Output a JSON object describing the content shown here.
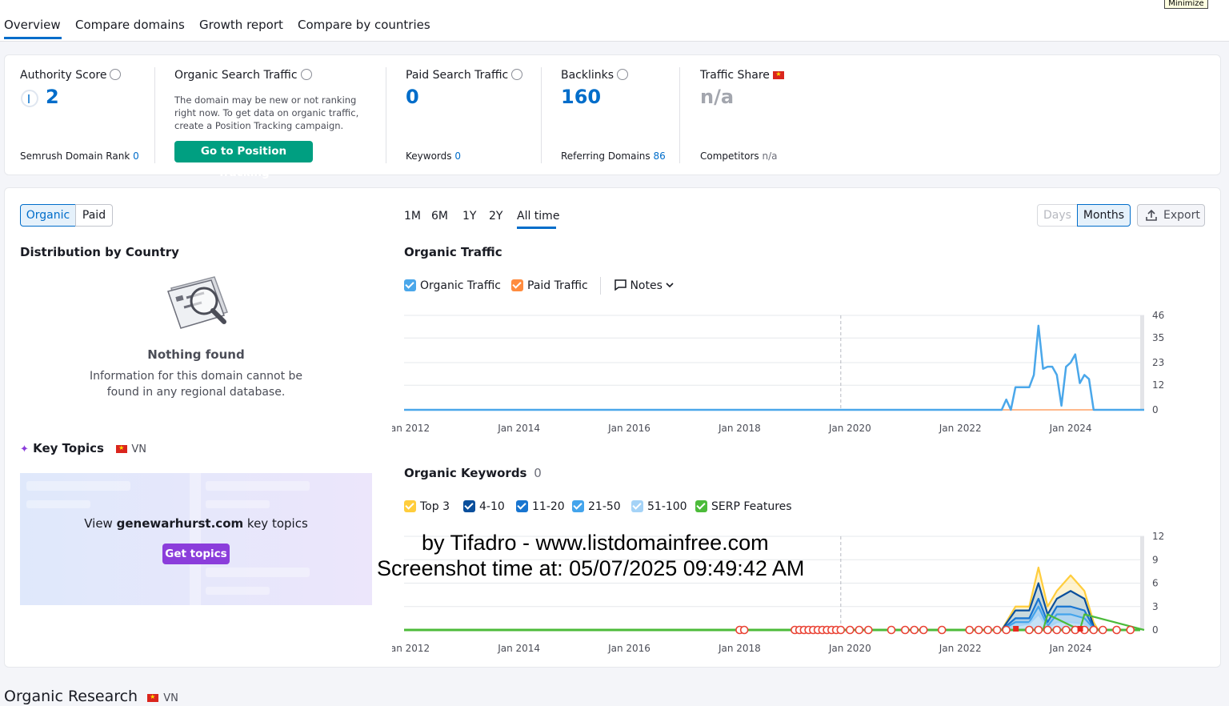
{
  "tabs": [
    "Overview",
    "Compare domains",
    "Growth report",
    "Compare by countries"
  ],
  "minimize_label": "Minimize",
  "metrics": {
    "authority": {
      "label": "Authority Score",
      "value": "2",
      "sub_label": "Semrush Domain Rank",
      "sub_value": "0"
    },
    "organic": {
      "label": "Organic Search Traffic",
      "note_lines": [
        "The domain may be new or not ranking",
        "right now. To get data on organic traffic,",
        "create a Position Tracking campaign."
      ],
      "button": "Go to Position Tracking"
    },
    "paid": {
      "label": "Paid Search Traffic",
      "value": "0",
      "sub_label": "Keywords",
      "sub_value": "0"
    },
    "backlinks": {
      "label": "Backlinks",
      "value": "160",
      "sub_label": "Referring Domains",
      "sub_value": "86"
    },
    "share": {
      "label": "Traffic Share",
      "value": "n/a",
      "sub_label": "Competitors",
      "sub_value": "n/a"
    }
  },
  "toggle": {
    "organic": "Organic",
    "paid": "Paid"
  },
  "ranges": [
    "1M",
    "6M",
    "1Y",
    "2Y",
    "All time"
  ],
  "granularity": {
    "days": "Days",
    "months": "Months"
  },
  "export_label": "Export",
  "distribution": {
    "title": "Distribution by Country",
    "empty_title": "Nothing found",
    "empty_lines": [
      "Information for this domain cannot be",
      "found in any regional database."
    ]
  },
  "key_topics": {
    "title": "Key Topics",
    "country": "VN",
    "view_prefix": "View",
    "domain": "genewarhurst.com",
    "view_suffix": "key topics",
    "button": "Get topics"
  },
  "traffic_chart": {
    "title": "Organic Traffic",
    "legend": [
      "Organic Traffic",
      "Paid Traffic"
    ],
    "notes": "Notes"
  },
  "keywords_chart": {
    "title": "Organic Keywords",
    "count": "0",
    "legend": [
      "Top 3",
      "4-10",
      "11-20",
      "21-50",
      "51-100",
      "SERP Features"
    ]
  },
  "watermark": {
    "line1": "by Tifadro - www.listdomainfree.com",
    "line2": "Screenshot time at: 05/07/2025 09:49:42 AM"
  },
  "footer": {
    "title": "Organic Research",
    "country": "VN"
  },
  "colors": {
    "accent": "#006dca",
    "green": "#009f81",
    "purple": "#8b3ddb",
    "organic": "#4aa7ea",
    "paid": "#ff8c3f"
  },
  "chart_data": [
    {
      "type": "line",
      "title": "Organic Traffic",
      "x_ticks": [
        "Jan 2012",
        "Jan 2014",
        "Jan 2016",
        "Jan 2018",
        "Jan 2020",
        "Jan 2022",
        "Jan 2024"
      ],
      "y_ticks": [
        "0",
        "12",
        "23",
        "35",
        "46"
      ],
      "ylim": [
        0,
        46
      ],
      "series": [
        {
          "name": "Organic Traffic",
          "x": [
            "2011-12",
            "2022-10",
            "2022-11",
            "2022-12",
            "2023-01",
            "2023-02",
            "2023-03",
            "2023-04",
            "2023-05",
            "2023-06",
            "2023-07",
            "2023-08",
            "2023-09",
            "2023-10",
            "2023-11",
            "2023-12",
            "2024-01",
            "2024-02",
            "2024-03",
            "2024-04",
            "2024-05",
            "2024-06",
            "2024-07",
            "2025-05"
          ],
          "values": [
            0,
            0,
            5,
            0,
            11,
            11,
            11,
            11,
            17,
            41,
            20,
            21,
            21,
            17,
            2,
            21,
            23,
            27,
            13,
            17,
            15,
            0,
            0,
            0
          ]
        },
        {
          "name": "Paid Traffic",
          "x": [
            "2011-12",
            "2025-05"
          ],
          "values": [
            0,
            0
          ]
        }
      ]
    },
    {
      "type": "area",
      "title": "Organic Keywords",
      "x_ticks": [
        "Jan 2012",
        "Jan 2014",
        "Jan 2016",
        "Jan 2018",
        "Jan 2020",
        "Jan 2022",
        "Jan 2024"
      ],
      "y_ticks": [
        "0",
        "3",
        "6",
        "9",
        "12"
      ],
      "ylim": [
        0,
        12
      ],
      "series": [
        {
          "name": "Top 3",
          "x": [
            "2022-10",
            "2023-01",
            "2023-04",
            "2023-06",
            "2023-08",
            "2023-10",
            "2024-01",
            "2024-04",
            "2024-06",
            "2024-07"
          ],
          "values": [
            0,
            3,
            3,
            8,
            3,
            5,
            7,
            5,
            1,
            0
          ]
        },
        {
          "name": "4-10",
          "x": [
            "2022-10",
            "2023-01",
            "2023-04",
            "2023-06",
            "2023-08",
            "2023-10",
            "2024-01",
            "2024-04",
            "2024-06",
            "2024-07"
          ],
          "values": [
            0,
            2.5,
            2.5,
            6,
            2,
            4,
            5,
            4,
            0.5,
            0
          ]
        },
        {
          "name": "11-20",
          "x": [
            "2022-10",
            "2023-01",
            "2023-04",
            "2023-06",
            "2023-08",
            "2023-10",
            "2024-01",
            "2024-04",
            "2024-06",
            "2024-07"
          ],
          "values": [
            0,
            1.5,
            1.5,
            4,
            1,
            3,
            3,
            2.5,
            0.3,
            0
          ]
        },
        {
          "name": "21-50",
          "x": [
            "2022-10",
            "2023-01",
            "2023-04",
            "2023-06",
            "2023-08",
            "2023-10",
            "2024-01",
            "2024-04",
            "2024-06",
            "2024-07"
          ],
          "values": [
            0,
            1,
            1,
            3,
            0.5,
            2,
            2,
            1.5,
            0.2,
            0
          ]
        },
        {
          "name": "51-100",
          "x": [
            "2022-10",
            "2023-01",
            "2023-04",
            "2023-06",
            "2023-08",
            "2023-10",
            "2024-01",
            "2024-04",
            "2024-06",
            "2024-07"
          ],
          "values": [
            0,
            0.5,
            0.8,
            2,
            0.3,
            1,
            1,
            0.8,
            0.1,
            0
          ]
        },
        {
          "name": "SERP Features",
          "x": [
            "2011-12",
            "2023-07",
            "2023-08",
            "2024-03",
            "2024-04",
            "2025-05"
          ],
          "values": [
            0,
            0,
            2,
            0,
            2,
            0
          ]
        }
      ]
    }
  ]
}
